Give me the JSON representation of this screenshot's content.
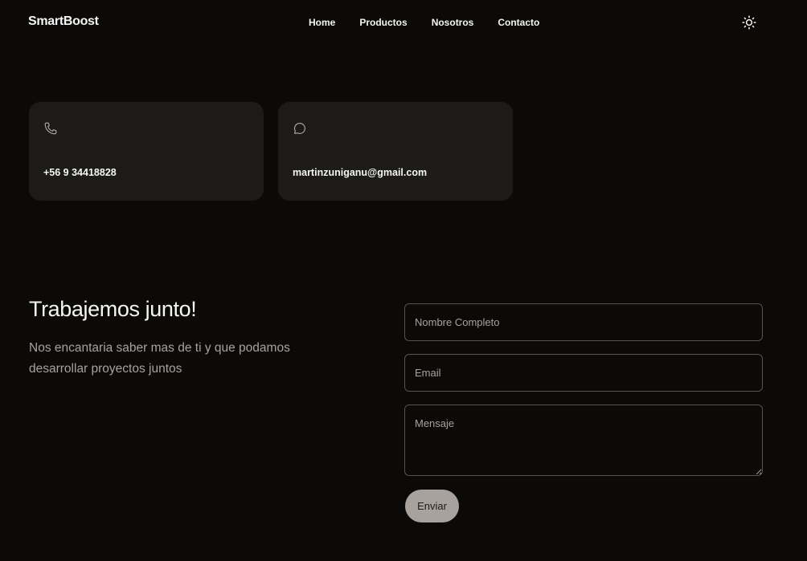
{
  "nav": {
    "brand": "SmartBoost",
    "links": [
      "Home",
      "Productos",
      "Nosotros",
      "Contacto"
    ],
    "theme_icon": "sun-icon"
  },
  "contact": {
    "phone": {
      "icon": "phone-icon",
      "value": "+56 9 34418828"
    },
    "email": {
      "icon": "chat-bubble-icon",
      "value": "martinzuniganu@gmail.com"
    }
  },
  "cta": {
    "title": "Trabajemos junto!",
    "text": "Nos encantaria saber mas de ti y que podamos desarrollar proyectos juntos"
  },
  "form": {
    "name_placeholder": "Nombre Completo",
    "email_placeholder": "Email",
    "message_placeholder": "Mensaje",
    "submit_label": "Enviar"
  },
  "colors": {
    "background": "#0c0a09",
    "card": "#1c1b1a",
    "button": "#a8a29e"
  }
}
